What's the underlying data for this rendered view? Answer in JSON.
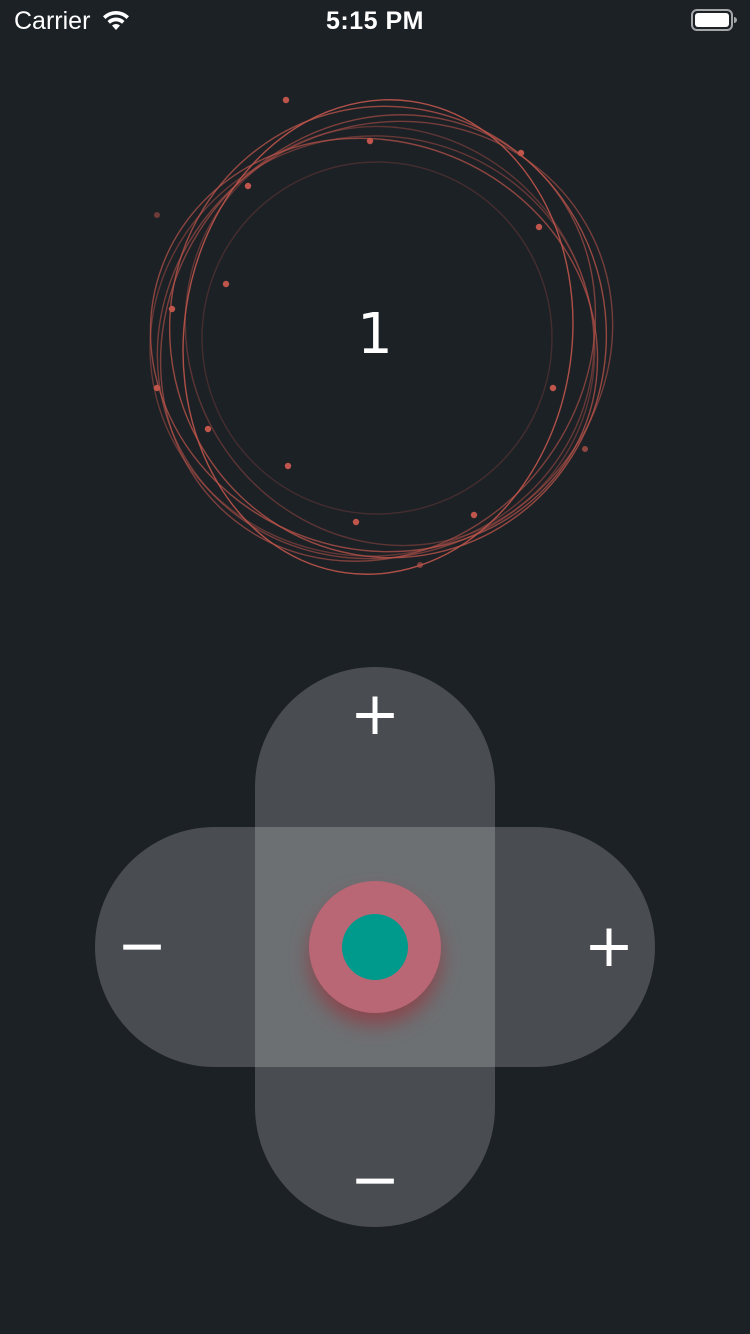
{
  "status_bar": {
    "carrier": "Carrier",
    "time": "5:15 PM",
    "wifi_icon": "wifi-icon",
    "battery_icon": "battery-full-icon"
  },
  "counter": {
    "value": "1"
  },
  "dpad": {
    "up_label": "+",
    "down_label": "−",
    "left_label": "−",
    "right_label": "+"
  },
  "colors": {
    "background": "#1c2126",
    "ring_stroke": "#c0554b",
    "joystick_outer": "#b96675",
    "joystick_inner": "#009a8c",
    "pad_fill": "rgba(255,255,255,0.2)"
  }
}
